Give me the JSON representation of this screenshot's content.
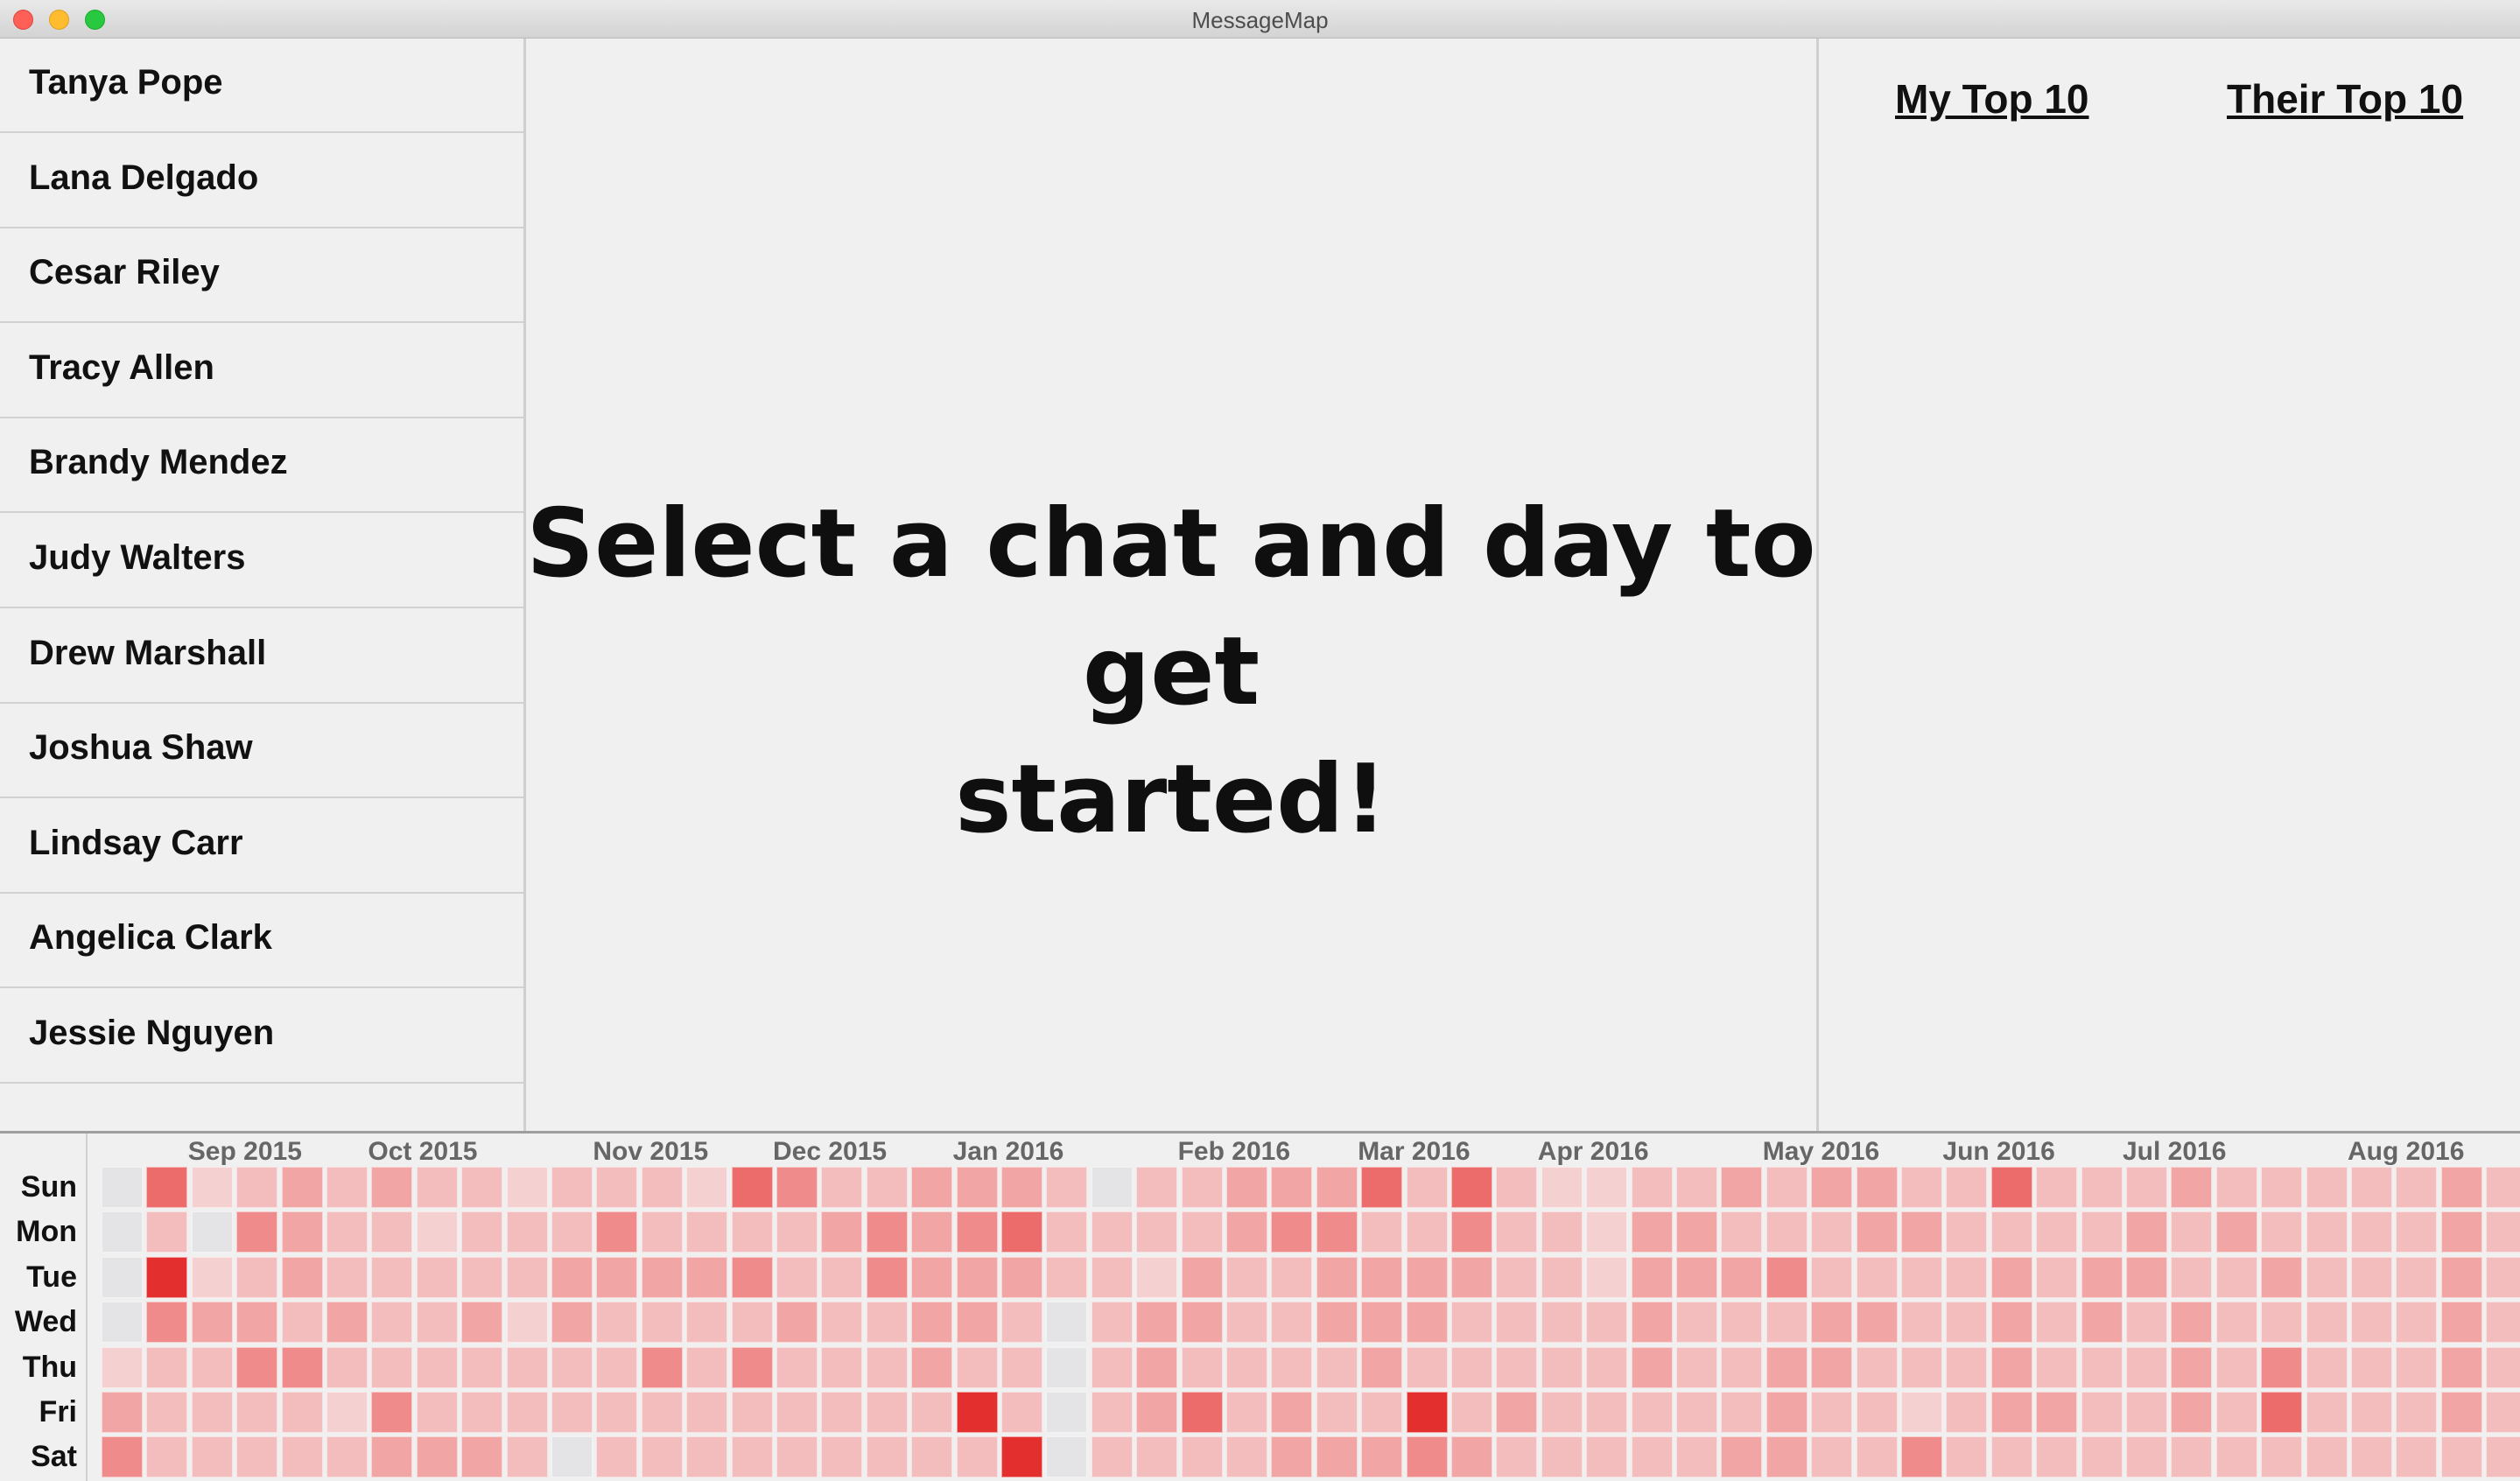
{
  "window": {
    "title": "MessageMap"
  },
  "sidebar": {
    "chats": [
      "Tanya Pope",
      "Lana Delgado",
      "Cesar Riley",
      "Tracy Allen",
      "Brandy Mendez",
      "Judy Walters",
      "Drew Marshall",
      "Joshua Shaw",
      "Lindsay Carr",
      "Angelica Clark",
      "Jessie Nguyen"
    ]
  },
  "main": {
    "prompt_line1": "Select a chat and day to get",
    "prompt_line2": "started!"
  },
  "right_panel": {
    "my_top": "My Top 10",
    "their_top": "Their Top 10"
  },
  "calendar": {
    "weekdays": [
      "Sun",
      "Mon",
      "Tue",
      "Wed",
      "Thu",
      "Fri",
      "Sat"
    ],
    "months": [
      {
        "label": "Sep 2015",
        "week": 2
      },
      {
        "label": "Oct 2015",
        "week": 6
      },
      {
        "label": "Nov 2015",
        "week": 11
      },
      {
        "label": "Dec 2015",
        "week": 15
      },
      {
        "label": "Jan 2016",
        "week": 19
      },
      {
        "label": "Feb 2016",
        "week": 24
      },
      {
        "label": "Mar 2016",
        "week": 28
      },
      {
        "label": "Apr 2016",
        "week": 32
      },
      {
        "label": "May 2016",
        "week": 37
      },
      {
        "label": "Jun 2016",
        "week": 41
      },
      {
        "label": "Jul 2016",
        "week": 45
      },
      {
        "label": "Aug 2016",
        "week": 50
      }
    ],
    "colors": {
      "empty": "#e4e4e6",
      "scale": [
        "#f5d0d0",
        "#f3bdbd",
        "#f2a5a5",
        "#ef8b8b",
        "#ec6c6c",
        "#e42f2f"
      ]
    },
    "grid": [
      [
        -1,
        4,
        0,
        1,
        2,
        1,
        2,
        1,
        1,
        0,
        1,
        1,
        1,
        0,
        4,
        3,
        1,
        1,
        2,
        2,
        2,
        1,
        -1,
        1,
        1,
        2,
        2,
        2,
        4,
        1,
        4,
        1,
        0,
        0,
        1,
        1,
        2,
        1,
        2,
        2,
        1,
        1,
        4,
        1,
        1,
        1,
        2,
        1,
        1,
        1,
        1,
        1,
        2,
        1,
        1,
        1
      ],
      [
        -1,
        1,
        -1,
        3,
        2,
        1,
        1,
        0,
        1,
        1,
        1,
        3,
        1,
        1,
        1,
        1,
        2,
        3,
        2,
        3,
        4,
        1,
        1,
        1,
        1,
        2,
        3,
        3,
        1,
        1,
        3,
        1,
        1,
        0,
        2,
        2,
        1,
        1,
        1,
        2,
        2,
        1,
        1,
        1,
        1,
        2,
        1,
        2,
        1,
        1,
        1,
        1,
        2,
        1,
        1,
        4
      ],
      [
        -1,
        5,
        0,
        1,
        2,
        1,
        1,
        1,
        1,
        1,
        2,
        2,
        2,
        2,
        3,
        1,
        1,
        3,
        2,
        2,
        2,
        1,
        1,
        0,
        2,
        1,
        1,
        2,
        2,
        2,
        2,
        1,
        1,
        0,
        2,
        2,
        2,
        3,
        1,
        1,
        1,
        1,
        2,
        1,
        2,
        2,
        1,
        1,
        2,
        1,
        1,
        1,
        2,
        1,
        1,
        1
      ],
      [
        -1,
        3,
        2,
        2,
        1,
        2,
        1,
        1,
        2,
        0,
        2,
        1,
        1,
        1,
        1,
        2,
        1,
        1,
        2,
        2,
        1,
        -1,
        1,
        2,
        2,
        1,
        1,
        2,
        2,
        2,
        1,
        1,
        1,
        1,
        2,
        1,
        1,
        1,
        2,
        2,
        1,
        1,
        2,
        1,
        2,
        1,
        2,
        1,
        1,
        1,
        1,
        1,
        2,
        1,
        2,
        1
      ],
      [
        0,
        1,
        1,
        3,
        3,
        1,
        1,
        1,
        1,
        1,
        1,
        1,
        3,
        1,
        3,
        1,
        1,
        1,
        2,
        1,
        1,
        -1,
        1,
        2,
        1,
        1,
        1,
        1,
        2,
        1,
        1,
        1,
        1,
        1,
        2,
        1,
        1,
        2,
        2,
        1,
        1,
        1,
        2,
        1,
        1,
        1,
        2,
        1,
        3,
        1,
        1,
        1,
        2,
        1,
        1,
        1
      ],
      [
        2,
        1,
        1,
        1,
        1,
        0,
        3,
        1,
        1,
        1,
        1,
        1,
        1,
        1,
        1,
        1,
        1,
        1,
        1,
        5,
        1,
        -1,
        1,
        2,
        4,
        1,
        2,
        1,
        1,
        5,
        1,
        2,
        1,
        1,
        1,
        1,
        1,
        2,
        1,
        1,
        0,
        1,
        2,
        2,
        1,
        1,
        2,
        1,
        4,
        1,
        1,
        1,
        2,
        1,
        1,
        1
      ],
      [
        3,
        1,
        1,
        1,
        1,
        1,
        2,
        2,
        2,
        1,
        -1,
        1,
        1,
        1,
        1,
        1,
        1,
        1,
        1,
        1,
        5,
        -1,
        1,
        1,
        1,
        1,
        2,
        2,
        2,
        3,
        2,
        1,
        1,
        1,
        1,
        1,
        2,
        2,
        1,
        1,
        3,
        1,
        1,
        1,
        1,
        1,
        1,
        1,
        1,
        1,
        1,
        1,
        1,
        1,
        1,
        1
      ]
    ]
  }
}
